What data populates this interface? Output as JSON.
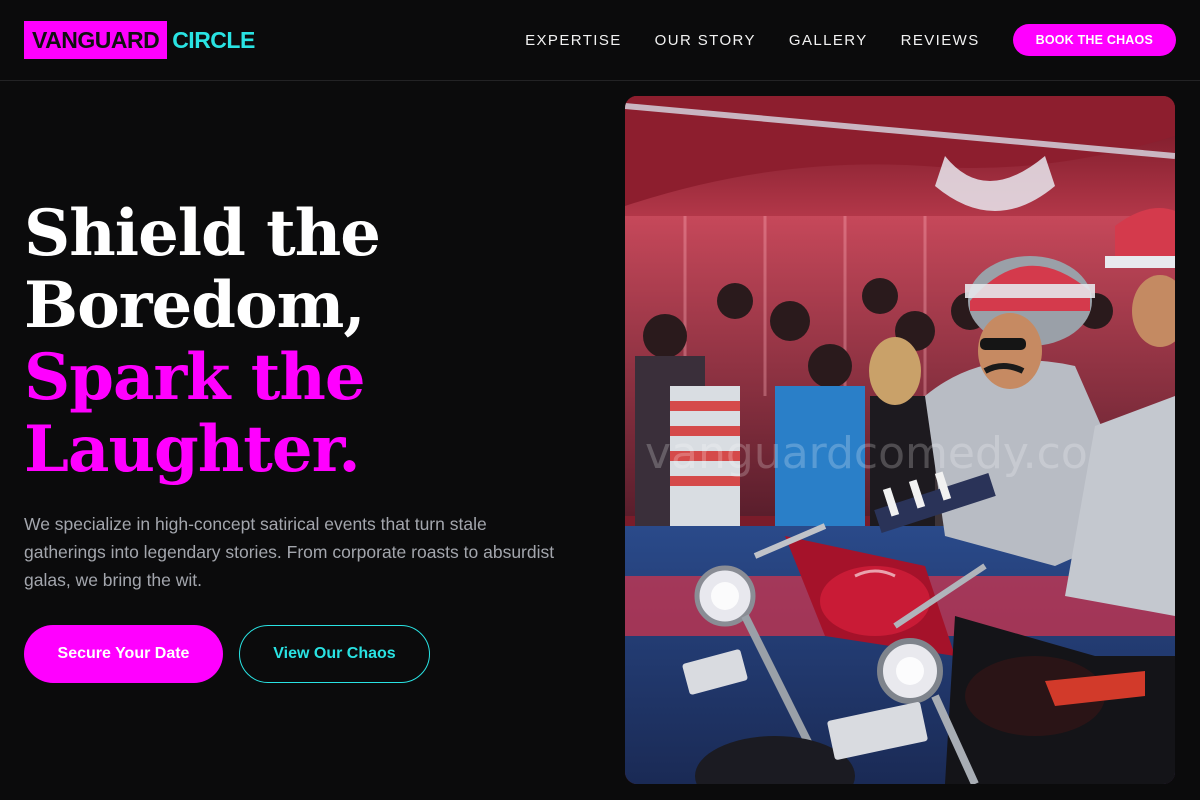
{
  "brand": {
    "box_text": "VANGUARD",
    "accent_text": "CIRCLE",
    "box_color": "#ff00ff",
    "accent_color": "#29e3e3"
  },
  "nav": {
    "items": [
      "EXPERTISE",
      "OUR STORY",
      "GALLERY",
      "REVIEWS"
    ],
    "cta": "BOOK THE CHAOS"
  },
  "hero": {
    "title_lines": [
      "Shield the",
      "Boredom,"
    ],
    "highlight_lines": [
      "Spark the",
      "Laughter."
    ],
    "description": "We specialize in high-concept satirical events that turn stale gatherings into legendary stories. From corporate roasts to absurdist galas, we bring the wit.",
    "primary_button": "Secure Your Date",
    "secondary_button": "View Our Chaos",
    "image_watermark": "vanguardcomedy.co"
  },
  "colors": {
    "background": "#0b0b0c",
    "highlight": "#ff00ff",
    "accent": "#29e3e3",
    "muted_text": "#a3a6ad"
  }
}
